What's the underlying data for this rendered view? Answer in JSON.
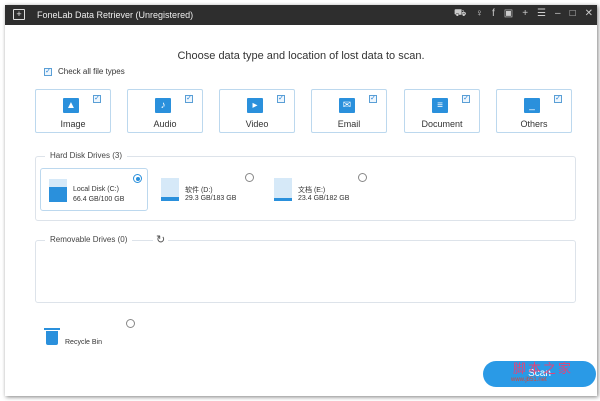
{
  "window": {
    "title": "FoneLab Data Retriever (Unregistered)",
    "controls": [
      "cart-icon",
      "key-icon",
      "facebook-icon",
      "feedback-icon",
      "plus-icon",
      "menu-icon",
      "minimize-icon",
      "maximize-icon",
      "close-icon"
    ]
  },
  "main": {
    "heading": "Choose data type and location of lost data to scan.",
    "check_all_label": "Check all file types",
    "file_types": [
      {
        "label": "Image",
        "checked": true
      },
      {
        "label": "Audio",
        "checked": true
      },
      {
        "label": "Video",
        "checked": true
      },
      {
        "label": "Email",
        "checked": true
      },
      {
        "label": "Document",
        "checked": true
      },
      {
        "label": "Others",
        "checked": true
      }
    ],
    "hard_disk": {
      "label": "Hard Disk Drives (3)",
      "drives": [
        {
          "name": "Local Disk (C:)",
          "usage": "66.4 GB/100 GB",
          "used_fraction": 0.664,
          "selected": true
        },
        {
          "name": "软件 (D:)",
          "usage": "29.3 GB/183 GB",
          "used_fraction": 0.16,
          "selected": false
        },
        {
          "name": "文档 (E:)",
          "usage": "23.4 GB/182 GB",
          "used_fraction": 0.13,
          "selected": false
        }
      ]
    },
    "removable": {
      "label": "Removable Drives (0)"
    },
    "recycle_bin": {
      "label": "Recycle Bin",
      "selected": false
    },
    "scan_label": "Scan",
    "watermark": {
      "text": "脚本之家",
      "url": "www.jb51.net"
    }
  }
}
